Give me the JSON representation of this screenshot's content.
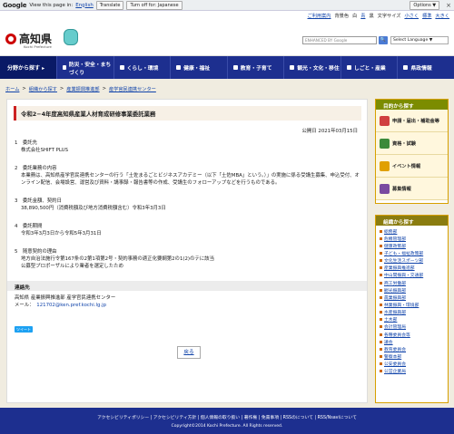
{
  "google_bar": {
    "logo": "Google",
    "view_text": "View this page in:",
    "language": "English",
    "translate": "Translate",
    "turn_off": "Turn off for: Japanese",
    "options": "Options ▼",
    "close": "×"
  },
  "top_links": {
    "sitemap": "ご利用案内",
    "backcolor": "背景色",
    "color_white": "白",
    "color_blue": "青",
    "color_black": "黒",
    "fontsize": "文字サイズ",
    "small": "小さく",
    "standard": "標準",
    "large": "大きく"
  },
  "header": {
    "logo_text": "高知県",
    "logo_sub": "Kochi Prefecture",
    "search_placeholder": "ENHANCED BY Google",
    "search_button": "🔍",
    "language_select": "Select Language ▼"
  },
  "nav": {
    "first": "分野から探す ▸",
    "items": [
      "防災・安全・まちづくり",
      "くらし・環境",
      "健康・福祉",
      "教育・子育て",
      "観光・文化・移住",
      "しごと・産業",
      "県政情報"
    ]
  },
  "breadcrumb": [
    "ホーム",
    "組織から探す",
    "産業振興推進部",
    "産学官民連携センター"
  ],
  "main": {
    "title": "令和2−4年度高知県産業人材育成研修事業委託業務",
    "date": "公開日 2021年03月15日",
    "sections": [
      {
        "heading": "1　委託先",
        "body": "株式会社SHIFT PLUS"
      },
      {
        "heading": "2　委託業務の内容",
        "body": "本業務は、高知県産学官民連携センターの行う「土佐まるごとビジネスアカデミー（以下「土佐MBA」という。）」の実施に係る受講生募集、申込受付、オンライン配信、会場設営、運営及び資料・講事録・報告書等の作成、受講生のフォローアップなどを行うものである。"
      },
      {
        "heading": "3　委託金額、契約日",
        "body": "38,890,500円（消費税額及び地方消費税額含む）令和3年3月3日"
      },
      {
        "heading": "4　委託期間",
        "body": "令和3年3月3日から令和5年3月31日"
      },
      {
        "heading": "5　随意契約の理由",
        "body": "地方自治法施行令第167条の2第1項第2号・契約事務の適正化要綱第2の1(2)のテに該当\n公募型プロポーザルにより業者を選定したため"
      }
    ],
    "contact_heading": "連絡先",
    "contact_org": "高知県 産業振興推進部 産学官民連携センター",
    "contact_mail_label": "メール：",
    "contact_mail": "121702@ken.pref.kochi.lg.jp",
    "tweet": "ツイート",
    "back": "戻る"
  },
  "sidebar": {
    "purpose_heading": "目的から探す",
    "purpose_items": [
      {
        "label": "申請・届出・補助金等",
        "icon": "document-icon",
        "color": "#d04040"
      },
      {
        "label": "資格・試験",
        "icon": "pencil-icon",
        "color": "#3a8a3a"
      },
      {
        "label": "イベント情報",
        "icon": "flag-icon",
        "color": "#e0a000"
      },
      {
        "label": "募集情報",
        "icon": "people-icon",
        "color": "#7a4aa0"
      }
    ],
    "org_heading": "組織から探す",
    "org_items": [
      "総務部",
      "危機管理部",
      "健康政策部",
      "子ども・福祉政策部",
      "文化生活スポーツ部",
      "産業振興推進部",
      "中山間振興・交通部",
      "商工労働部",
      "観光振興部",
      "農業振興部",
      "林業振興・環境部",
      "水産振興部",
      "土木部",
      "会計管理局",
      "各種委員会等",
      "議会",
      "教育委員会",
      "警察本部",
      "公安委員会",
      "公営企業局"
    ]
  },
  "footer": {
    "links": "アクセシビリティポリシー | アクセシビリティ方針 | 個人情報の取り扱い | 著作権 | 免責事項 | RSSのについて | RSS/Nsaviについて",
    "copyright": "Copyright©2014 Kochi Prefecture. All Rights reserved."
  }
}
